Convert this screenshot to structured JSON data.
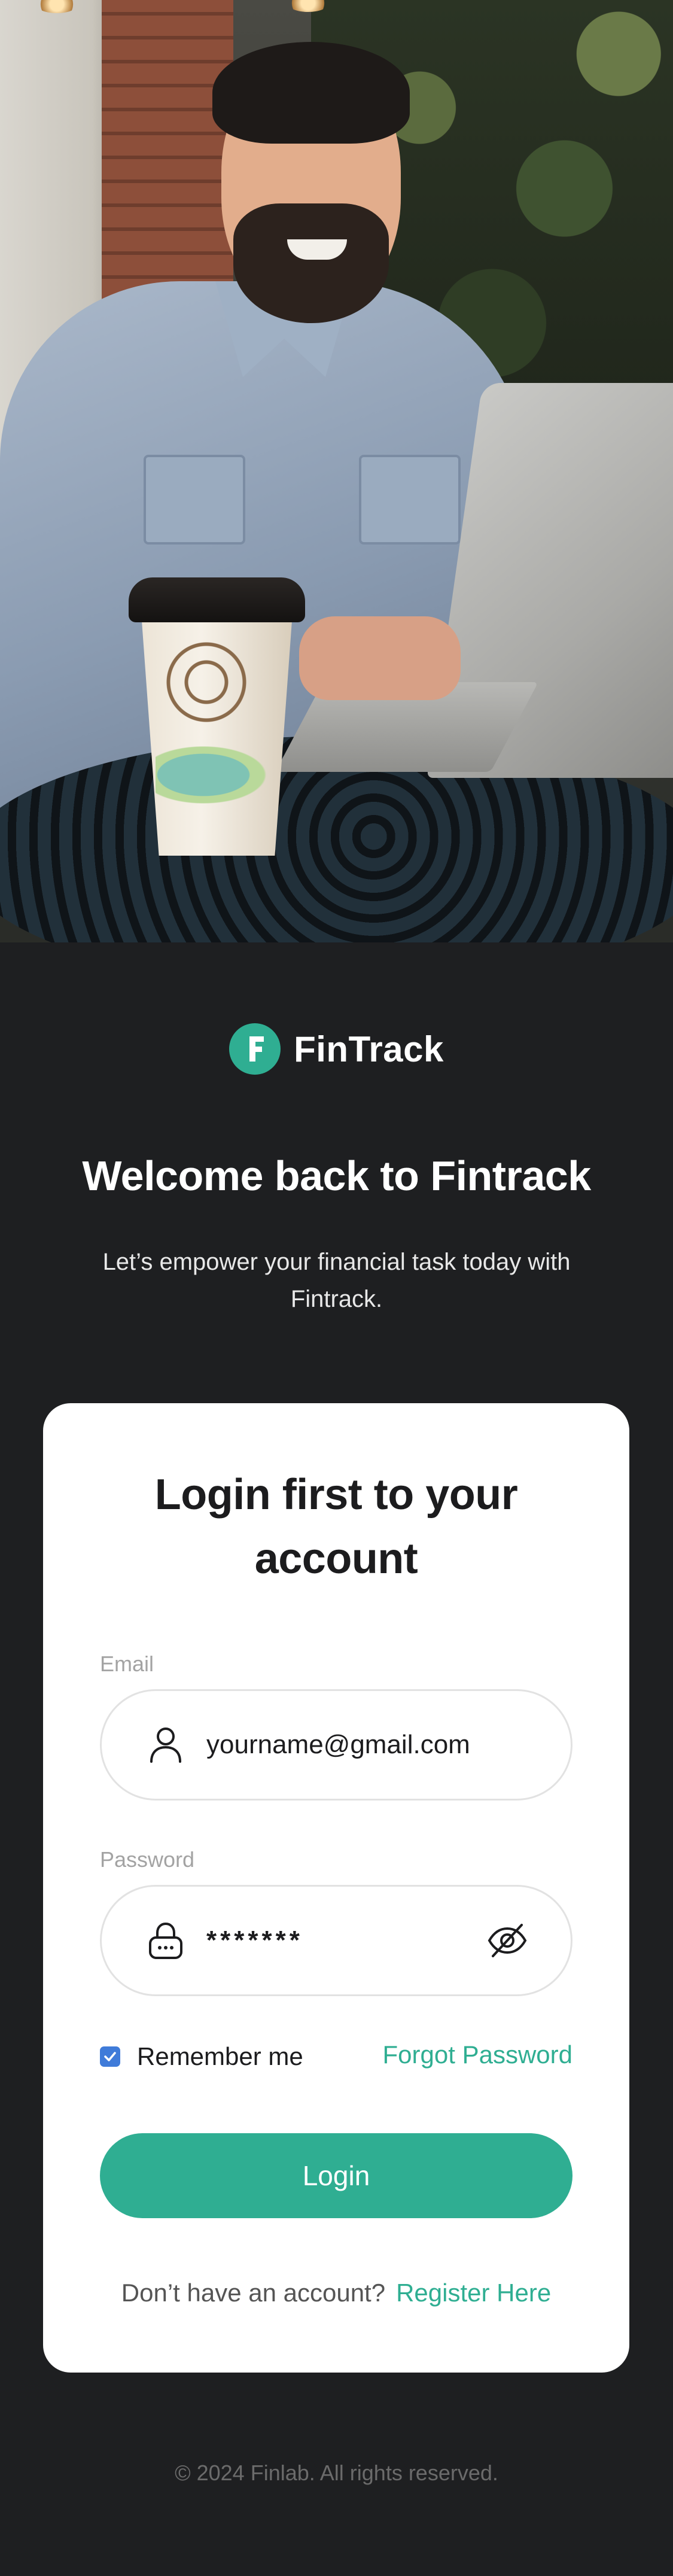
{
  "hero": {
    "image_label": "man-with-laptop-and-coffee-photo"
  },
  "brand": {
    "logo_letter": "F",
    "name": "FinTrack",
    "color": "#2fae92"
  },
  "header": {
    "welcome": "Welcome back to Fintrack",
    "tagline": "Let’s empower your financial task today with Fintrack."
  },
  "login_card": {
    "title": "Login first to your account",
    "email": {
      "label": "Email",
      "value": "yourname@gmail.com",
      "icon": "user-icon"
    },
    "password": {
      "label": "Password",
      "value": "*******",
      "icon": "lock-icon",
      "toggle_icon": "eye-off-icon"
    },
    "remember_me": {
      "label": "Remember me",
      "checked": true
    },
    "forgot_password": "Forgot Password",
    "login_button": "Login",
    "register_prompt": "Don’t have an account?",
    "register_link": "Register Here"
  },
  "footer": {
    "copyright": "© 2024 Finlab. All rights reserved."
  },
  "colors": {
    "background": "#1e1f21",
    "card": "#ffffff",
    "accent": "#2fae92",
    "checkbox": "#3f7bd9"
  }
}
